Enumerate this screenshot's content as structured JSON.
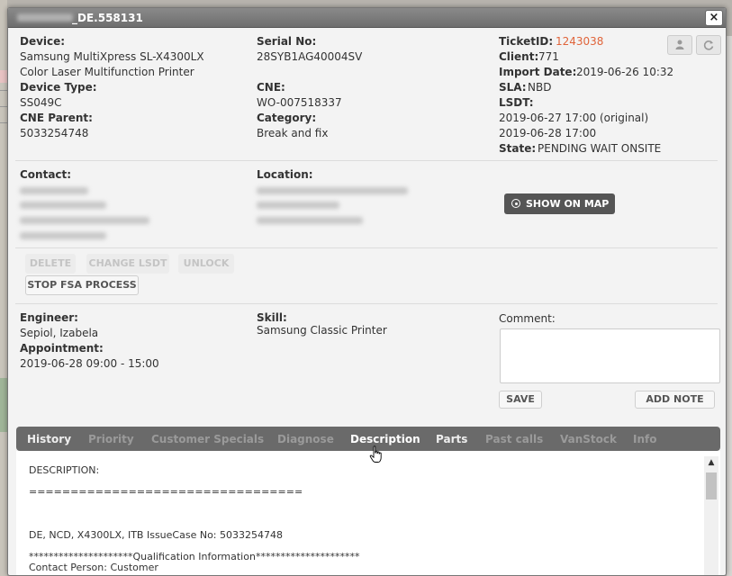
{
  "window": {
    "title": "_DE.558131",
    "close_label": "×"
  },
  "device": {
    "device_label": "Device:",
    "device_line1": "Samsung MultiXpress SL-X4300LX",
    "device_line2": "Color Laser Multifunction Printer",
    "device_type_label": "Device Type:",
    "device_type": "SS049C",
    "cne_parent_label": "CNE Parent:",
    "cne_parent": "5033254748",
    "serial_label": "Serial No:",
    "serial": "28SYB1AG40004SV",
    "cne_label": "CNE:",
    "cne": "WO-007518337",
    "category_label": "Category:",
    "category": "Break and fix"
  },
  "ticket": {
    "ticket_id_label": "TicketID:",
    "ticket_id": "1243038",
    "client_label": "Client:",
    "client": "771",
    "import_date_label": "Import Date:",
    "import_date": "2019-06-26 10:32",
    "sla_label": "SLA:",
    "sla": "NBD",
    "lsdt_label": "LSDT:",
    "lsdt_original": "2019-06-27 17:00 (original)",
    "lsdt_current": "2019-06-28 17:00",
    "state_label": "State:",
    "state": "PENDING WAIT ONSITE"
  },
  "contact": {
    "contact_label": "Contact:",
    "location_label": "Location:",
    "map_button": "SHOW ON MAP"
  },
  "actions": {
    "delete": "DELETE",
    "change_lsdt": "CHANGE LSDT",
    "unlock": "UNLOCK",
    "stop_fsa": "STOP FSA PROCESS"
  },
  "engineer": {
    "engineer_label": "Engineer:",
    "engineer": "Sepiol, Izabela",
    "appointment_label": "Appointment:",
    "appointment": "2019-06-28 09:00 - 15:00",
    "skill_label": "Skill:",
    "skill": "Samsung Classic Printer",
    "comment_label": "Comment:",
    "save": "SAVE",
    "add_note": "ADD NOTE"
  },
  "tabs": [
    {
      "label": "History",
      "state": "enabled"
    },
    {
      "label": "Priority",
      "state": "disabled"
    },
    {
      "label": "Customer Specials",
      "state": "disabled"
    },
    {
      "label": "Diagnose",
      "state": "disabled"
    },
    {
      "label": "Description",
      "state": "active"
    },
    {
      "label": "Parts",
      "state": "enabled"
    },
    {
      "label": "Past calls",
      "state": "disabled"
    },
    {
      "label": "VanStock",
      "state": "disabled"
    },
    {
      "label": "Info",
      "state": "disabled"
    }
  ],
  "description": {
    "line1": "DESCRIPTION:",
    "line2": "=================================",
    "line3": "DE, NCD, X4300LX, ITB IssueCase No: 5033254748",
    "line4": "*********************Qualification Information*********************",
    "line5": "Contact Person: Customer"
  },
  "icons": {
    "user": "user-icon",
    "refresh": "refresh-icon",
    "pin": "map-pin-icon",
    "scroll_up": "chevron-up-icon",
    "cursor": "hand-cursor-icon"
  },
  "colors": {
    "ticket_link": "#e0643a",
    "tabbar": "#6a6a6a",
    "map_button": "#555555"
  }
}
